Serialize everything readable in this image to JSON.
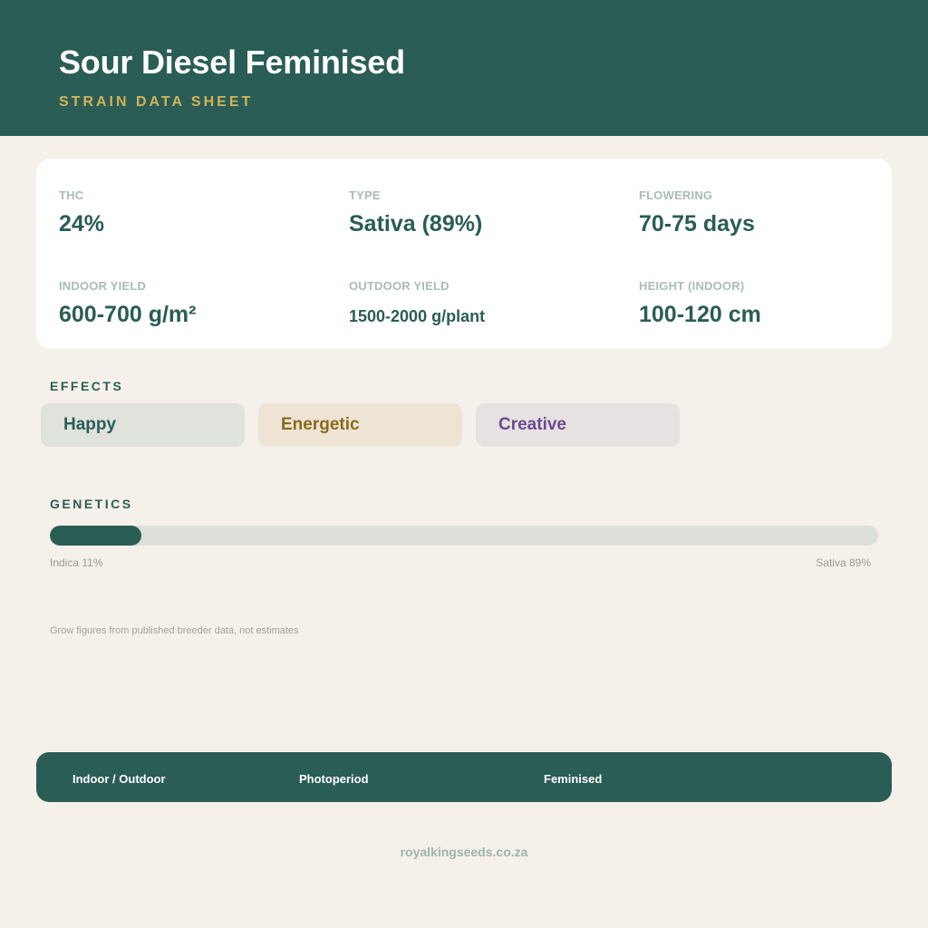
{
  "header": {
    "title": "Sour Diesel Feminised",
    "subtitle": "STRAIN DATA SHEET"
  },
  "stats": [
    {
      "label": "THC",
      "value": "24%"
    },
    {
      "label": "TYPE",
      "value": "Sativa (89%)"
    },
    {
      "label": "FLOWERING",
      "value": "70-75 days"
    },
    {
      "label": "INDOOR YIELD",
      "value": "600-700 g/m²"
    },
    {
      "label": "OUTDOOR YIELD",
      "value": "1500-2000 g/plant"
    },
    {
      "label": "HEIGHT (INDOOR)",
      "value": "100-120 cm"
    }
  ],
  "effects": {
    "title": "EFFECTS",
    "items": [
      "Happy",
      "Energetic",
      "Creative"
    ]
  },
  "genetics": {
    "title": "GENETICS",
    "indica_label": "Indica 11%",
    "sativa_label": "Sativa 89%",
    "indica_fraction": 0.11
  },
  "footnote": "Grow figures from published breeder data, not estimates",
  "footer": {
    "tags": [
      "Indoor / Outdoor",
      "Photoperiod",
      "Feminised"
    ]
  },
  "site": "royalkingseeds.co.za",
  "colors": {
    "primary": "#2a5d55",
    "accent": "#d2b356",
    "background": "#f5f0ea"
  }
}
